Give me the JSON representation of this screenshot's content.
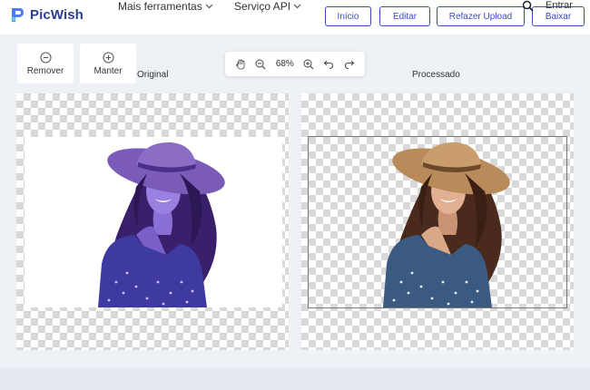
{
  "header": {
    "logo_text": "PicWish",
    "nav": [
      {
        "label": "Mais ferramentas"
      },
      {
        "label": "Serviço API"
      }
    ],
    "buttons": {
      "home": "Início",
      "edit": "Editar",
      "reupload": "Refazer Upload",
      "download": "Baixar"
    },
    "login": "Entrar"
  },
  "tools": {
    "remove": "Remover",
    "keep": "Manter"
  },
  "zoom": {
    "value": "68%"
  },
  "panes": {
    "original_label": "Original",
    "processed_label": "Processado"
  },
  "colors": {
    "accent": "#3b4cc0",
    "brand_text": "#2c3e8f",
    "original_tint": "#5b3fc4"
  },
  "icons": [
    "picwish-logo-icon",
    "chevron-down-icon",
    "search-icon",
    "minus-circle-icon",
    "plus-circle-icon",
    "hand-icon",
    "zoom-out-icon",
    "zoom-in-icon",
    "undo-icon",
    "redo-icon"
  ]
}
